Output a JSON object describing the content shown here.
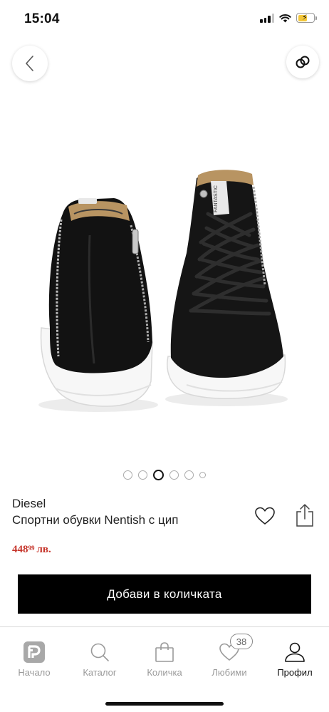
{
  "status_bar": {
    "time": "15:04"
  },
  "product": {
    "brand": "Diesel",
    "name": "Спортни обувки Nentish с цип",
    "price_main": "448",
    "price_cents": "99",
    "price_currency": "лв.",
    "image_icon": "product-photo-sneakers"
  },
  "carousel": {
    "count": 6,
    "active_index": 2
  },
  "actions": {
    "add_to_cart": "Добави в количката",
    "back_icon": "chevron-left-icon",
    "link_icon": "link-icon",
    "favorite_icon": "heart-icon",
    "share_icon": "share-icon"
  },
  "bottom_nav": {
    "items": [
      {
        "label": "Начало",
        "icon": "home-logo-icon"
      },
      {
        "label": "Каталог",
        "icon": "search-icon"
      },
      {
        "label": "Количка",
        "icon": "bag-icon"
      },
      {
        "label": "Любими",
        "icon": "heart-icon",
        "badge": "38"
      },
      {
        "label": "Профил",
        "icon": "user-icon",
        "active": true
      }
    ]
  },
  "colors": {
    "price": "#c6352b",
    "button_bg": "#000000",
    "nav_inactive": "#9a9a9a",
    "nav_active": "#111111",
    "battery": "#f3c63a"
  }
}
